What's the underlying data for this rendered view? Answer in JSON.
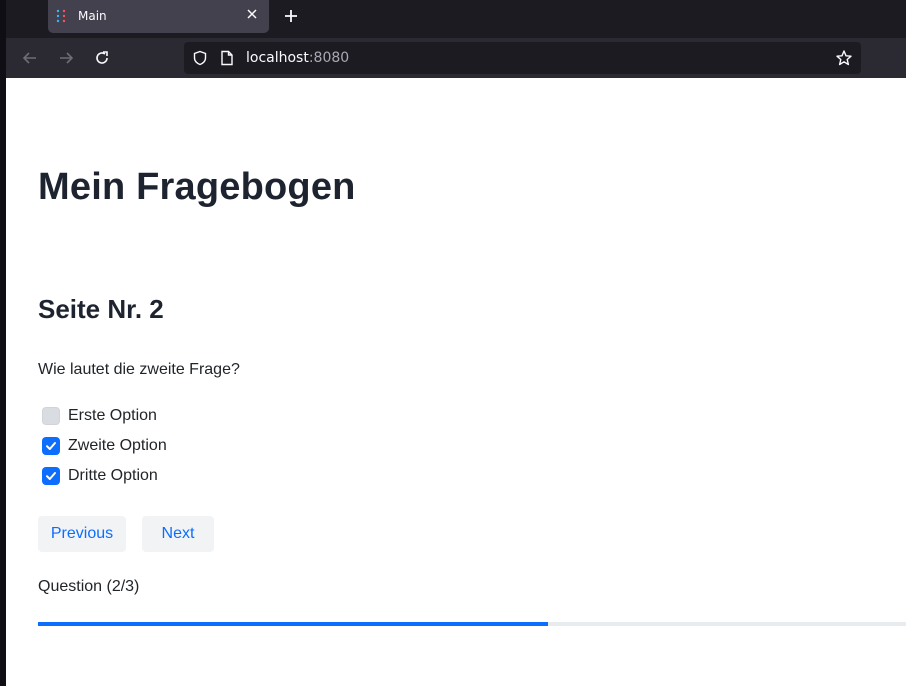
{
  "browser": {
    "tab_title": "Main",
    "url_host": "localhost",
    "url_port": ":8080"
  },
  "survey": {
    "title": "Mein Fragebogen",
    "page_heading": "Seite Nr. 2",
    "question": "Wie lautet die zweite Frage?",
    "options": [
      {
        "label": "Erste Option",
        "checked": false
      },
      {
        "label": "Zweite Option",
        "checked": true
      },
      {
        "label": "Dritte Option",
        "checked": true
      }
    ],
    "previous_label": "Previous",
    "next_label": "Next",
    "progress_text": "Question (2/3)",
    "progress_fraction": 0.587
  },
  "colors": {
    "accent": "#0d6efd",
    "heading": "#1e2330",
    "chrome_dark": "#1c1b22"
  }
}
